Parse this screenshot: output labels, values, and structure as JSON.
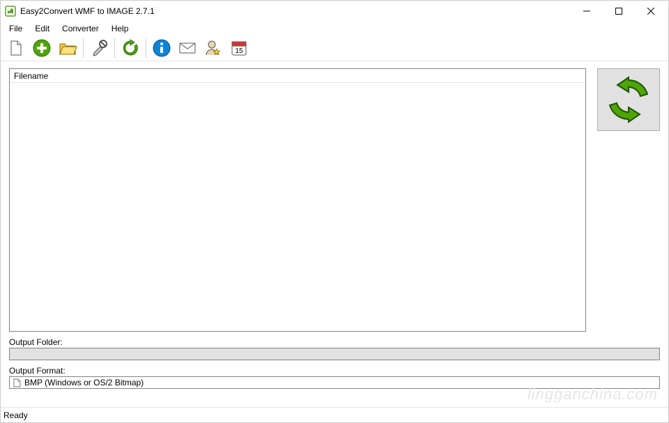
{
  "window": {
    "title": "Easy2Convert WMF to IMAGE 2.7.1"
  },
  "menubar": {
    "items": [
      "File",
      "Edit",
      "Converter",
      "Help"
    ]
  },
  "toolbar": {
    "buttons": [
      "new-file",
      "add-file",
      "open-folder",
      "sep",
      "settings-wrench",
      "sep",
      "refresh",
      "sep",
      "info",
      "mail",
      "user-star",
      "calendar-15"
    ]
  },
  "filelist": {
    "header": "Filename"
  },
  "output_folder": {
    "label": "Output Folder:",
    "value": ""
  },
  "output_format": {
    "label": "Output Format:",
    "value": "BMP (Windows or OS/2 Bitmap)"
  },
  "statusbar": {
    "text": "Ready"
  },
  "watermark": "lingganchina.com"
}
